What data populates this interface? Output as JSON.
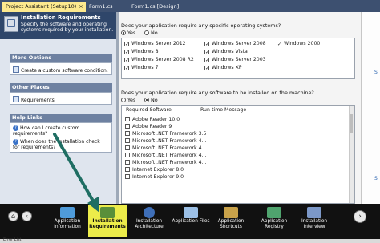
{
  "tabs": [
    {
      "label": "Project Assistant (Setup10)",
      "active": true
    },
    {
      "label": "Form1.cs",
      "active": false
    },
    {
      "label": "Form1.cs [Design]",
      "active": false
    }
  ],
  "header": {
    "title": "Installation Requirements",
    "description": "Specify the software and operating systems required by your installation."
  },
  "sidebar": {
    "more_options": {
      "title": "More Options",
      "links": [
        "Create a custom software condition."
      ]
    },
    "other_places": {
      "title": "Other Places",
      "links": [
        "Requirements"
      ]
    },
    "help_links": {
      "title": "Help Links",
      "links": [
        "How can I create custom requirements?",
        "When does the installation check for requirements?"
      ]
    }
  },
  "os_question": {
    "text": "Does your application require any specific operating systems?",
    "yes": "Yes",
    "no": "No",
    "selected": "yes",
    "columns": [
      [
        {
          "label": "Windows Server 2012",
          "checked": true
        },
        {
          "label": "Windows 8",
          "checked": true
        },
        {
          "label": "Windows Server 2008 R2",
          "checked": true
        },
        {
          "label": "Windows 7",
          "checked": true
        }
      ],
      [
        {
          "label": "Windows Server 2008",
          "checked": true
        },
        {
          "label": "Windows Vista",
          "checked": true
        },
        {
          "label": "Windows Server 2003",
          "checked": true
        },
        {
          "label": "Windows XP",
          "checked": true
        }
      ],
      [
        {
          "label": "Windows 2000",
          "checked": true
        }
      ]
    ]
  },
  "software_question": {
    "text": "Does your application require any software to be installed on the machine?",
    "yes": "Yes",
    "no": "No",
    "selected": "no",
    "col_required": "Required Software",
    "col_runtime": "Run-time Message",
    "items": [
      "Adobe Reader 10.0",
      "Adobe Reader 9",
      "Microsoft .NET Framework 3.5",
      "Microsoft .NET Framework 4...",
      "Microsoft .NET Framework 4...",
      "Microsoft .NET Framework 4...",
      "Microsoft .NET Framework 4...",
      "Internet Explorer 8.0",
      "Internet Explorer 9.0"
    ]
  },
  "nav": {
    "items": [
      {
        "label": "Application Information",
        "color": "#4f9bd9"
      },
      {
        "label": "Installation Requirements",
        "color": "#5a8f3a",
        "active": true
      },
      {
        "label": "Installation Architecture",
        "color": "#3f6fb8"
      },
      {
        "label": "Application Files",
        "color": "#9cc0e6"
      },
      {
        "label": "Application Shortcuts",
        "color": "#c9a24a"
      },
      {
        "label": "Application Registry",
        "color": "#4fa46e"
      },
      {
        "label": "Installation Interview",
        "color": "#7c98c8"
      }
    ]
  },
  "bottom_label": "Error List",
  "colors": {
    "highlight": "#ecec4a",
    "arrow": "#1f6e63"
  }
}
